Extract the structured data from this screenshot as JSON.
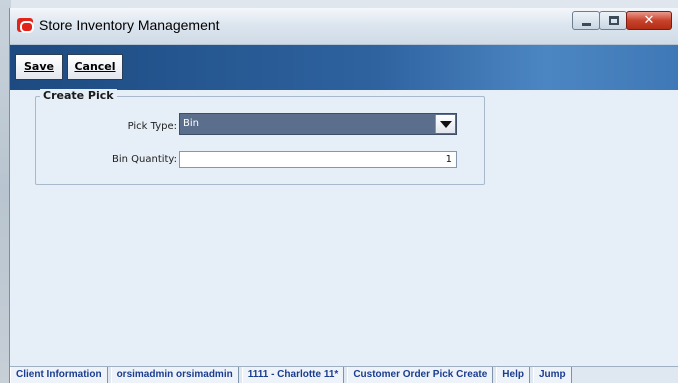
{
  "window": {
    "title": "Store Inventory Management",
    "buttons": [
      "minimize",
      "maximize",
      "close"
    ]
  },
  "toolbar": {
    "save_label": "Save",
    "cancel_label": "Cancel"
  },
  "form": {
    "group_title": "Create Pick",
    "pick_type_label": "Pick Type:",
    "pick_type_value": "Bin",
    "bin_quantity_label": "Bin Quantity:",
    "bin_quantity_value": "1"
  },
  "statusbar": {
    "items": [
      "Client Information",
      "orsimadmin orsimadmin",
      "1111 - Charlotte 11*",
      "Customer Order Pick Create",
      "Help",
      "Jump"
    ]
  },
  "colors": {
    "toolbar_dark": "#1d4a80",
    "toolbar_light": "#4c86c2",
    "status_text": "#1a3d8f",
    "select_bg": "#5b6f8c"
  },
  "icons": {
    "app": "oracle-app-icon",
    "dropdown": "chevron-down-icon"
  }
}
